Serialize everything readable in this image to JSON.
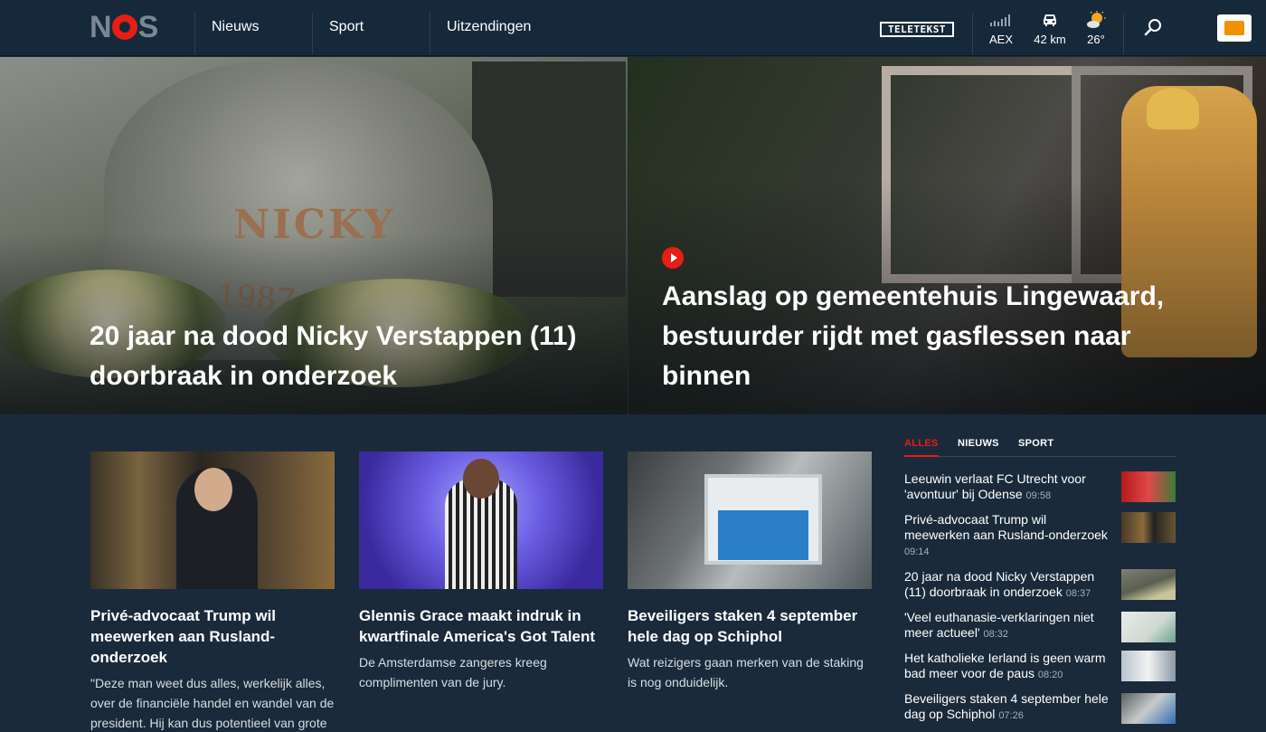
{
  "header": {
    "logo": "NOS",
    "nav": [
      "Nieuws",
      "Sport",
      "Uitzendingen"
    ],
    "teletekst": "TELETEKST",
    "widgets": [
      {
        "icon": "chart-icon",
        "label": "AEX"
      },
      {
        "icon": "car-icon",
        "label": "42 km"
      },
      {
        "icon": "weather-sun-icon",
        "label": "26°"
      }
    ],
    "npo_label": "NPO start"
  },
  "hero": [
    {
      "title": "20 jaar na dood Nicky Verstappen (11) doorbraak in onderzoek",
      "stone_name": "NICKY",
      "stone_years": "1987-1998"
    },
    {
      "title": "Aanslag op gemeentehuis Lingewaard, bestuurder rijdt met gasflessen naar binnen",
      "has_video": true
    }
  ],
  "articles": [
    {
      "title": "Privé-advocaat Trump wil meewerken aan Rusland-onderzoek",
      "lead": "\"Deze man weet dus alles, werkelijk alles, over de financiële handel en wandel van de president. Hij kan dus potentieel van grote"
    },
    {
      "title": "Glennis Grace maakt indruk in kwartfinale America's Got Talent",
      "lead": "De Amsterdamse zangeres kreeg complimenten van de jury."
    },
    {
      "title": "Beveiligers staken 4 september hele dag op Schiphol",
      "lead": "Wat reizigers gaan merken van de staking is nog onduidelijk."
    }
  ],
  "sidebar": {
    "tabs": [
      "ALLES",
      "NIEUWS",
      "SPORT"
    ],
    "active_tab": "ALLES",
    "items": [
      {
        "text": "Leeuwin verlaat FC Utrecht voor 'avontuur' bij Odense",
        "time": "09:58"
      },
      {
        "text": "Privé-advocaat Trump wil meewerken aan Rusland-onderzoek",
        "time": "09:14"
      },
      {
        "text": "20 jaar na dood Nicky Verstappen (11) doorbraak in onderzoek",
        "time": "08:37"
      },
      {
        "text": "'Veel euthanasie-verklaringen niet meer actueel'",
        "time": "08:32"
      },
      {
        "text": "Het katholieke Ierland is geen warm bad meer voor de paus",
        "time": "08:20"
      },
      {
        "text": "Beveiligers staken 4 september hele dag op Schiphol",
        "time": "07:26"
      }
    ]
  },
  "colors": {
    "accent": "#e61e14",
    "background": "#1a2a3b",
    "header": "#16293b"
  }
}
